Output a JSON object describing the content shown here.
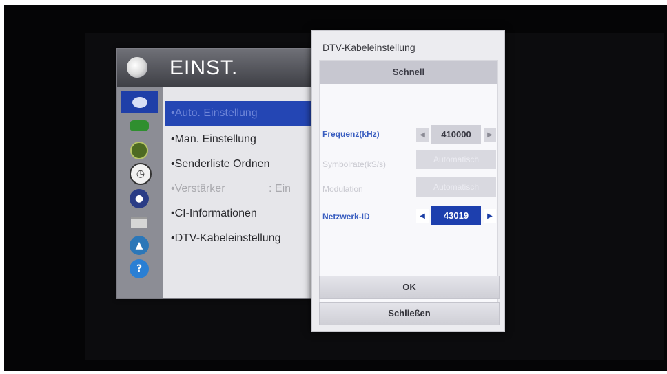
{
  "menu": {
    "title": "EINST.",
    "items": [
      {
        "label": "•Auto. Einstellung",
        "state": "selected"
      },
      {
        "label": "•Man. Einstellung",
        "state": "normal"
      },
      {
        "label": "•Senderliste Ordnen",
        "state": "normal"
      },
      {
        "label": "•Verstärker",
        "value": ": Ein",
        "state": "disabled"
      },
      {
        "label": "•CI-Informationen",
        "state": "normal"
      },
      {
        "label": "•DTV-Kabeleinstellung",
        "state": "normal"
      }
    ],
    "category_icons": [
      "picture-icon",
      "audio-icon",
      "time-icon",
      "clock-icon",
      "lock-icon",
      "option-icon",
      "network-icon",
      "help-icon"
    ]
  },
  "dialog": {
    "title": "DTV-Kabeleinstellung",
    "mode": "Schnell",
    "rows": [
      {
        "label": "Frequenz(kHz)",
        "value": "410000",
        "state": "normal"
      },
      {
        "label": "Symbolrate(kS/s)",
        "value": "Automatisch",
        "state": "disabled"
      },
      {
        "label": "Modulation",
        "value": "Automatisch",
        "state": "disabled"
      },
      {
        "label": "Netzwerk-ID",
        "value": "43019",
        "state": "active"
      }
    ],
    "ok_label": "OK",
    "close_label": "Schließen"
  },
  "colors": {
    "selection_blue": "#2446b4",
    "label_blue": "#3a5ec0"
  }
}
